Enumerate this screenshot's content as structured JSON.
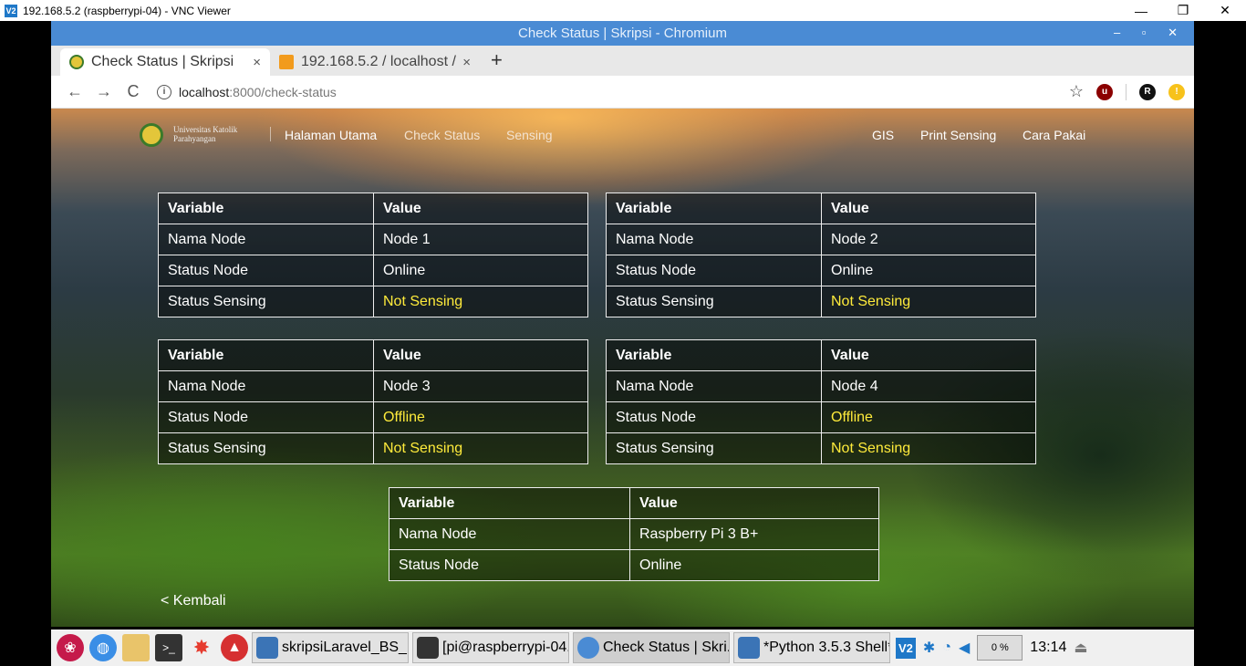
{
  "vnc": {
    "title": "192.168.5.2 (raspberrypi-04) - VNC Viewer",
    "logo": "V2",
    "minimize": "—",
    "restore": "❐",
    "close": "✕"
  },
  "chromium": {
    "window_title": "Check Status | Skripsi - Chromium",
    "window_controls": "– ▫ ✕",
    "tabs": [
      {
        "label": "Check Status | Skripsi",
        "close": "×"
      },
      {
        "label": "192.168.5.2 / localhost / ",
        "close": "×"
      }
    ],
    "new_tab": "+",
    "back": "←",
    "forward": "→",
    "reload": "C",
    "url_host": "localhost",
    "url_path": ":8000/check-status",
    "star": "☆"
  },
  "site": {
    "logo_text_line1": "Universitas Katolik",
    "logo_text_line2": "Parahyangan",
    "nav": {
      "home": "Halaman Utama",
      "check": "Check Status",
      "sensing": "Sensing",
      "gis": "GIS",
      "print": "Print Sensing",
      "guide": "Cara Pakai"
    },
    "header_variable": "Variable",
    "header_value": "Value",
    "nodes": [
      {
        "name_label": "Nama Node",
        "name": "Node 1",
        "status_label": "Status Node",
        "status": "Online",
        "sensing_label": "Status Sensing",
        "sensing": "Not Sensing"
      },
      {
        "name_label": "Nama Node",
        "name": "Node 2",
        "status_label": "Status Node",
        "status": "Online",
        "sensing_label": "Status Sensing",
        "sensing": "Not Sensing"
      },
      {
        "name_label": "Nama Node",
        "name": "Node 3",
        "status_label": "Status Node",
        "status": "Offline",
        "sensing_label": "Status Sensing",
        "sensing": "Not Sensing"
      },
      {
        "name_label": "Nama Node",
        "name": "Node 4",
        "status_label": "Status Node",
        "status": "Offline",
        "sensing_label": "Status Sensing",
        "sensing": "Not Sensing"
      }
    ],
    "gateway": {
      "name_label": "Nama Node",
      "name": "Raspberry Pi 3 B+",
      "status_label": "Status Node",
      "status": "Online"
    },
    "back": "< Kembali"
  },
  "taskbar": {
    "tasks": [
      "skripsiLaravel_BS_...",
      "[pi@raspberrypi-04...",
      "Check Status | Skri...",
      "*Python 3.5.3 Shell*"
    ],
    "cpu": "0 %",
    "clock": "13:14",
    "eject": "⏏"
  },
  "colors": {
    "warning": "#ffeb3b",
    "chrome_title": "#4a8bd4"
  }
}
